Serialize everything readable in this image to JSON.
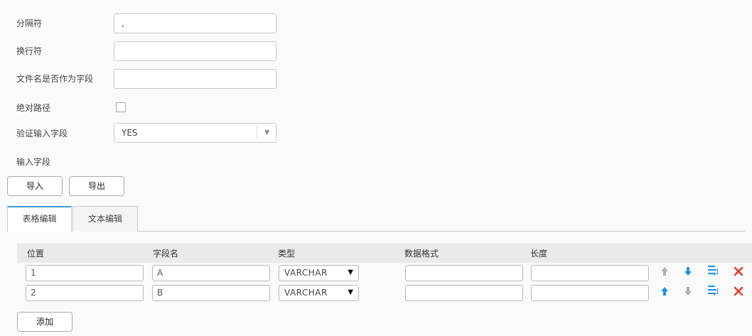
{
  "form": {
    "separator": {
      "label": "分隔符",
      "value": ","
    },
    "newline": {
      "label": "换行符",
      "value": ""
    },
    "filename_as_field": {
      "label": "文件名是否作为字段",
      "value": ""
    },
    "absolute_path": {
      "label": "绝对路径",
      "checked": false
    },
    "validate_input": {
      "label": "验证输入字段",
      "value": "YES"
    },
    "input_fields_label": "输入字段"
  },
  "buttons": {
    "import": "导入",
    "export": "导出",
    "add": "添加"
  },
  "tabs": [
    {
      "label": "表格编辑",
      "active": true
    },
    {
      "label": "文本编辑",
      "active": false
    }
  ],
  "table": {
    "columns": [
      "位置",
      "字段名",
      "类型",
      "数据格式",
      "长度"
    ],
    "rows": [
      {
        "position": "1",
        "name": "A",
        "type": "VARCHAR",
        "format": "",
        "length": ""
      },
      {
        "position": "2",
        "name": "B",
        "type": "VARCHAR",
        "format": "",
        "length": ""
      }
    ]
  },
  "icons": {
    "move_up": "arrow-up-icon",
    "move_down": "arrow-down-icon",
    "insert": "insert-row-icon",
    "delete": "delete-icon"
  },
  "colors": {
    "accent": "#1e90e8",
    "disabled": "#b0b0b0",
    "delete": "#e83a2a",
    "tab_active": "#3a9be3"
  }
}
